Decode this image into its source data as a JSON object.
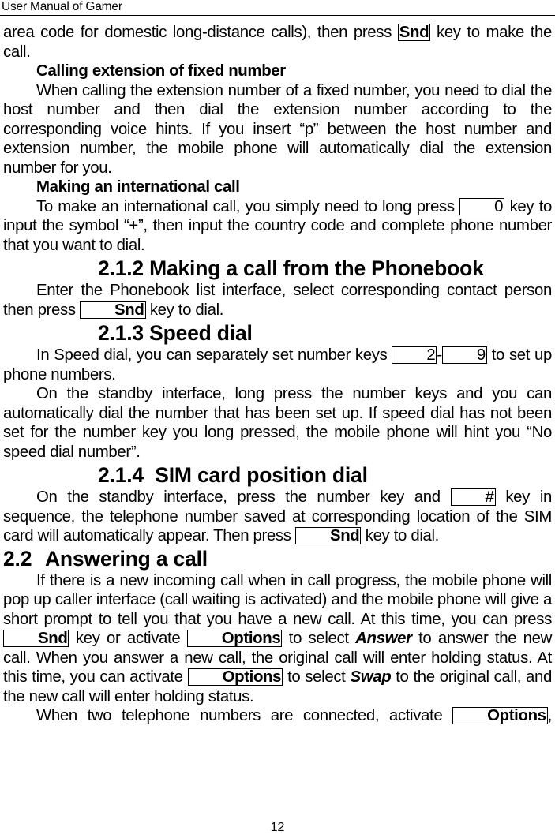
{
  "header": {
    "title": "User Manual of Gamer"
  },
  "footer": {
    "page_number": "12"
  },
  "blocks": [
    {
      "type": "p",
      "indent": false,
      "runs": [
        {
          "t": "area code for domestic long-distance calls), then press "
        },
        {
          "t": "Snd",
          "s": "keyb"
        },
        {
          "t": " key to make the call."
        }
      ]
    },
    {
      "type": "subhead",
      "text": "Calling extension of fixed number"
    },
    {
      "type": "p",
      "indent": true,
      "runs": [
        {
          "t": "When calling the extension number of a fixed number, you need to dial the host number and then dial the extension number according to the corresponding voice hints. If you insert “p” between the host number and extension number, the mobile phone will automatically dial the extension number for you."
        }
      ]
    },
    {
      "type": "subhead",
      "text": "Making an international call"
    },
    {
      "type": "p",
      "indent": true,
      "runs": [
        {
          "t": "To make an international call, you simply need to long press "
        },
        {
          "t": "0",
          "s": "key"
        },
        {
          "t": " key to input the symbol “+”, then input the country code and complete phone number that you want to dial."
        }
      ]
    },
    {
      "type": "h3",
      "text": "2.1.2 Making a call from the Phonebook"
    },
    {
      "type": "p",
      "indent": true,
      "runs": [
        {
          "t": "Enter the Phonebook list interface, select corresponding contact person then press "
        },
        {
          "t": "Snd",
          "s": "keyb"
        },
        {
          "t": " key to dial."
        }
      ]
    },
    {
      "type": "h3",
      "text": "2.1.3 Speed dial"
    },
    {
      "type": "p",
      "indent": true,
      "runs": [
        {
          "t": "In Speed dial, you can separately set number keys "
        },
        {
          "t": "2",
          "s": "key"
        },
        {
          "t": "-"
        },
        {
          "t": "9",
          "s": "key"
        },
        {
          "t": " to set up phone numbers."
        }
      ]
    },
    {
      "type": "p",
      "indent": true,
      "runs": [
        {
          "t": "On the standby interface, long press the number keys and you can automatically dial the number that has been set up. If speed dial has not been set for the number key you long pressed, the mobile phone will hint you “No speed dial number”."
        }
      ]
    },
    {
      "type": "h3",
      "text": "2.1.4  SIM card position dial"
    },
    {
      "type": "p",
      "indent": true,
      "runs": [
        {
          "t": "On the standby interface, press the number key and "
        },
        {
          "t": "#",
          "s": "key"
        },
        {
          "t": " key in sequence, the telephone number saved at corresponding location of the SIM card will automatically appear. Then press "
        },
        {
          "t": "Snd",
          "s": "keyb"
        },
        {
          "t": " key to dial."
        }
      ]
    },
    {
      "type": "h2",
      "num": "2.2",
      "text": "Answering a call"
    },
    {
      "type": "p",
      "indent": true,
      "runs": [
        {
          "t": "If there is a new incoming call when in call progress, the mobile phone will pop up caller interface (call waiting is activated) and the mobile phone will give a short prompt to tell you that you have a new call. At this time, you can press "
        },
        {
          "t": "Snd",
          "s": "keyb"
        },
        {
          "t": " key or activate "
        },
        {
          "t": "Options",
          "s": "keyb"
        },
        {
          "t": " to select "
        },
        {
          "t": "Answer",
          "s": "bi"
        },
        {
          "t": " to answer the new call. When you answer a new call, the original call will enter holding status. At this time, you can activate "
        },
        {
          "t": "Options",
          "s": "keyb"
        },
        {
          "t": " to select "
        },
        {
          "t": "Swap",
          "s": "bi"
        },
        {
          "t": " to the original call, and the new call will enter holding status."
        }
      ]
    },
    {
      "type": "p",
      "indent": true,
      "justify_last": true,
      "runs": [
        {
          "t": "When two telephone numbers are connected, activate "
        },
        {
          "t": "Options",
          "s": "keyb"
        },
        {
          "t": ","
        }
      ]
    }
  ]
}
